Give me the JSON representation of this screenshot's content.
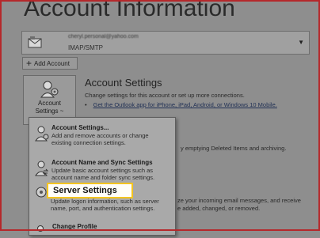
{
  "page": {
    "title": "Account Information"
  },
  "account": {
    "email": "cheryl.personal@yahoo.com",
    "type": "IMAP/SMTP"
  },
  "add_account": {
    "label": "Add Account"
  },
  "account_settings_button": {
    "label_line1": "Account",
    "label_line2": "Settings ~"
  },
  "section": {
    "title": "Account Settings",
    "description": "Change settings for this account or set up more connections.",
    "link": "Get the Outlook app for iPhone, iPad, Android, or Windows 10 Mobile."
  },
  "background_text": {
    "line1": "y emptying Deleted Items and archiving.",
    "line2": "ze your incoming email messages, and receive",
    "line3": "e added, changed, or removed."
  },
  "menu": {
    "items": [
      {
        "title": "Account Settings...",
        "description": "Add and remove accounts or change existing connection settings.",
        "icon": "people-gear-icon"
      },
      {
        "title": "Account Name and Sync Settings",
        "description": "Update basic account settings such as account name and folder sync settings.",
        "icon": "person-sync-icon"
      },
      {
        "title": "Server Settings",
        "description": "Update logon information, such as server name, port, and authentication settings.",
        "icon": "server-gear-icon"
      },
      {
        "title": "Change Profile",
        "description": "",
        "icon": "profile-icon"
      }
    ]
  },
  "colors": {
    "highlight_border": "#f3c41f",
    "screenshot_frame": "#b5282b"
  }
}
